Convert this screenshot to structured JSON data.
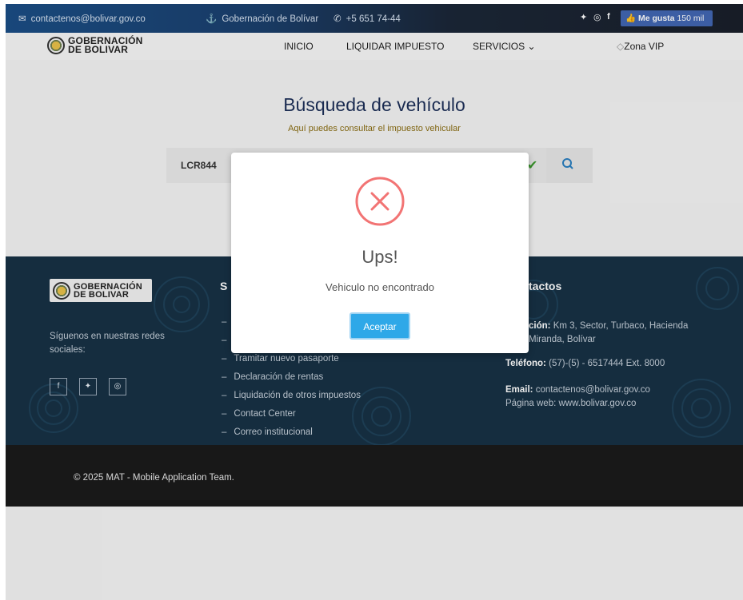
{
  "topbar": {
    "email": "contactenos@bolivar.gov.co",
    "org": "Gobernación de Bolívar",
    "phone": "+5 651 74-44",
    "fb_like_label": "Me gusta",
    "fb_like_count": "150 mil"
  },
  "nav": {
    "logo_line1": "GOBERNACIÓN",
    "logo_line2": "DE BOLIVAR",
    "items": [
      "INICIO",
      "LIQUIDAR IMPUESTO",
      "SERVICIOS ⌄",
      "Zona VIP"
    ]
  },
  "search": {
    "title": "Búsqueda de vehículo",
    "subtitle": "Aquí puedes consultar el impuesto vehicular",
    "plate_value": "LCR844"
  },
  "footer": {
    "logo_line1": "GOBERNACIÓN",
    "logo_line2": "DE BOLIVAR",
    "follow_text": "Síguenos en nuestras redes sociales:",
    "services_head": "S",
    "services": [
      "Tramitar nuevo pasaporte",
      "Declaración de rentas",
      "Liquidación de otros impuestos",
      "Contact Center",
      "Correo institucional"
    ],
    "contacts_head": "tactos",
    "address_label": "ción:",
    "address_text": "Km 3, Sector, Turbaco, Hacienda",
    "address_text2": "Miranda, Bolívar",
    "phone_label": "Teléfono:",
    "phone_text": "(57)-(5) - 6517444 Ext. 8000",
    "email_label": "Email:",
    "email_text": "contactenos@bolivar.gov.co",
    "web_text": "Página web: www.bolivar.gov.co",
    "copyright": "© 2025 MAT - Mobile Application Team."
  },
  "modal": {
    "title": "Ups!",
    "message": "Vehiculo no encontrado",
    "accept_label": "Aceptar"
  },
  "colors": {
    "accent": "#2ea8e8",
    "error": "#f27474",
    "title": "#1d2f58",
    "footer_bg": "#173145"
  }
}
